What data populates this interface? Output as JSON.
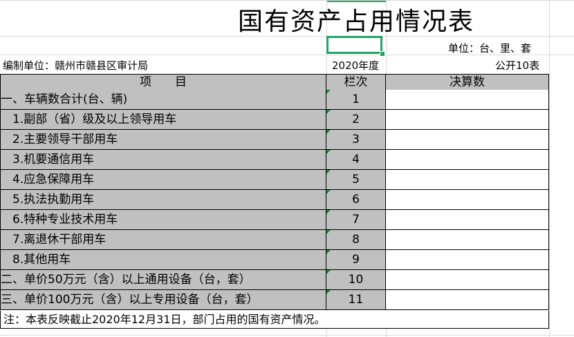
{
  "title": "国有资产占用情况表",
  "unit_label": "单位：台、里、套",
  "org_label": "编制单位：赣州市赣县区审计局",
  "year": "2020年度",
  "table_no": "公开10表",
  "header": {
    "item": "项　　目",
    "seq": "栏次",
    "amount": "决算数"
  },
  "rows": [
    {
      "item": "一、车辆数合计(台、辆)",
      "seq": "1",
      "amount": ""
    },
    {
      "item": "　1.副部（省）级及以上领导用车",
      "seq": "2",
      "amount": ""
    },
    {
      "item": "　2.主要领导干部用车",
      "seq": "3",
      "amount": ""
    },
    {
      "item": "　3.机要通信用车",
      "seq": "4",
      "amount": ""
    },
    {
      "item": "　4.应急保障用车",
      "seq": "5",
      "amount": ""
    },
    {
      "item": "　5.执法执勤用车",
      "seq": "6",
      "amount": ""
    },
    {
      "item": "　6.特种专业技术用车",
      "seq": "7",
      "amount": ""
    },
    {
      "item": "　7.离退休干部用车",
      "seq": "8",
      "amount": ""
    },
    {
      "item": "　8.其他用车",
      "seq": "9",
      "amount": ""
    },
    {
      "item": "二、单价50万元（含）以上通用设备（台，套）",
      "seq": "10",
      "amount": ""
    },
    {
      "item": "三、单价100万元（含）以上专用设备（台，套）",
      "seq": "11",
      "amount": ""
    }
  ],
  "note": "注：本表反映截止2020年12月31日，部门占用的国有资产情况。",
  "colors": {
    "accent": "#21a366",
    "header_fill": "#c0c0c0",
    "gridline": "#d9d9d9"
  }
}
